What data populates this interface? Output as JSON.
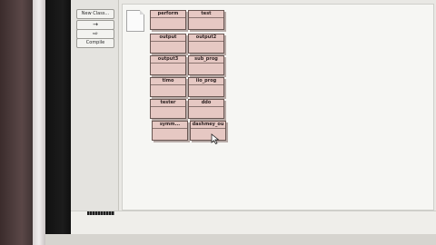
{
  "toolbar": {
    "new_class_label": "New Class...",
    "uses_arrow_label": "→",
    "inherits_arrow_label": "⇨",
    "compile_label": "Compile"
  },
  "classes": [
    {
      "name": "perform"
    },
    {
      "name": "test"
    },
    {
      "name": "output"
    },
    {
      "name": "output2"
    },
    {
      "name": "output3"
    },
    {
      "name": "sub_prog"
    },
    {
      "name": "timo"
    },
    {
      "name": "iio_prog"
    },
    {
      "name": "tester"
    },
    {
      "name": "ddo"
    },
    {
      "name": "symm..."
    },
    {
      "name": "dashmey_ou"
    }
  ],
  "colors": {
    "class_fill": "#e6c8c3",
    "class_border": "#6a5753",
    "canvas_bg": "#f6f6f3"
  }
}
